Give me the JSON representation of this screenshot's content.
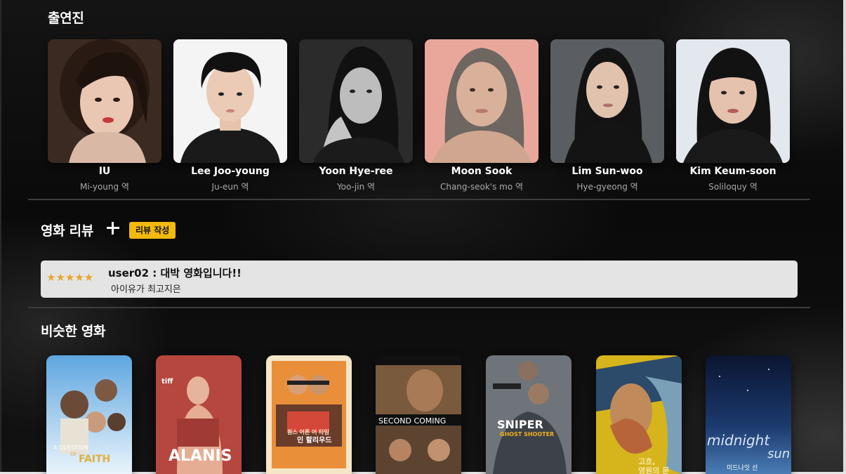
{
  "cast_section": {
    "title": "출연진",
    "members": [
      {
        "name": "IU",
        "role": "Mi-young 역"
      },
      {
        "name": "Lee Joo-young",
        "role": "Ju-eun 역"
      },
      {
        "name": "Yoon Hye-ree",
        "role": "Yoo-jin 역"
      },
      {
        "name": "Moon Sook",
        "role": "Chang-seok's mo 역"
      },
      {
        "name": "Lim Sun-woo",
        "role": "Hye-gyeong 역"
      },
      {
        "name": "Kim Keum-soon",
        "role": "Soliloquy 역"
      }
    ]
  },
  "review_section": {
    "title": "영화 리뷰",
    "add_icon": "plus-icon",
    "write_label": "리뷰 작성",
    "reviews": [
      {
        "stars": "★★★★★",
        "rating": 5,
        "title": "user02 : 대박 영화입니다!!",
        "body": "아이유가 최고지은"
      }
    ]
  },
  "similar_section": {
    "title": "비슷한 영화",
    "posters": [
      {
        "title_lines": [
          "A QUESTION",
          "OF",
          "FAITH"
        ]
      },
      {
        "title_lines": [
          "ALANIS"
        ],
        "badge": "tiff"
      },
      {
        "title_lines": [
          "원스 어폰 어 타임",
          "인 할리우드"
        ]
      },
      {
        "title_lines": [
          "SECOND COMING"
        ]
      },
      {
        "title_lines": [
          "SNIPER",
          "GHOST SHOOTER"
        ]
      },
      {
        "title_lines": [
          "고흐,",
          "영원의 문"
        ]
      },
      {
        "title_lines": [
          "midnight",
          "sun",
          "미드나잇 선"
        ]
      }
    ]
  },
  "colors": {
    "accent": "#f2b90f",
    "star": "#e8a530",
    "review_bg": "#e4e4e4",
    "page_bg": "#0b0b0b"
  }
}
